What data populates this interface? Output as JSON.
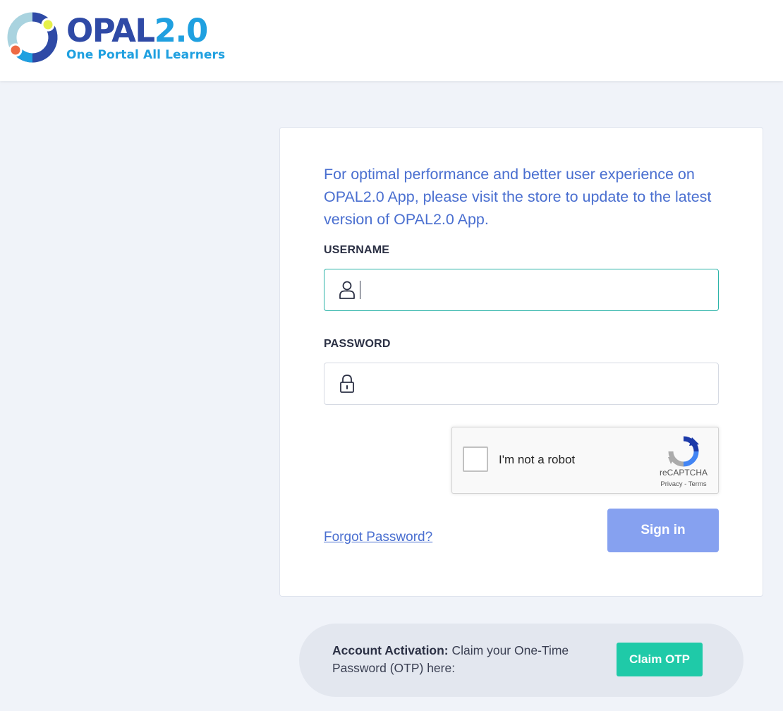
{
  "header": {
    "logo_word_main": "OPAL",
    "logo_word_version": "2.0",
    "logo_tagline": "One Portal All Learners"
  },
  "login": {
    "notice": "For optimal performance and better user experience on OPAL2.0 App, please visit the store to update to the latest version of OPAL2.0 App.",
    "username_label": "USERNAME",
    "username_value": "",
    "username_icon": "user-icon",
    "password_label": "PASSWORD",
    "password_value": "",
    "password_icon": "lock-icon",
    "forgot_label": "Forgot Password?",
    "signin_label": "Sign in"
  },
  "captcha": {
    "label": "I'm not a robot",
    "brand": "reCAPTCHA",
    "links": "Privacy - Terms",
    "checked": false
  },
  "activation": {
    "bold_label": "Account Activation:",
    "text": " Claim your One-Time Password (OTP) here:",
    "button_label": "Claim OTP"
  },
  "colors": {
    "brand_blue": "#2f4aa6",
    "accent_blue": "#4a6fd0",
    "signin_button": "#86a1f0",
    "otp_button": "#1fcaa8",
    "page_background": "#f0f3f9"
  }
}
